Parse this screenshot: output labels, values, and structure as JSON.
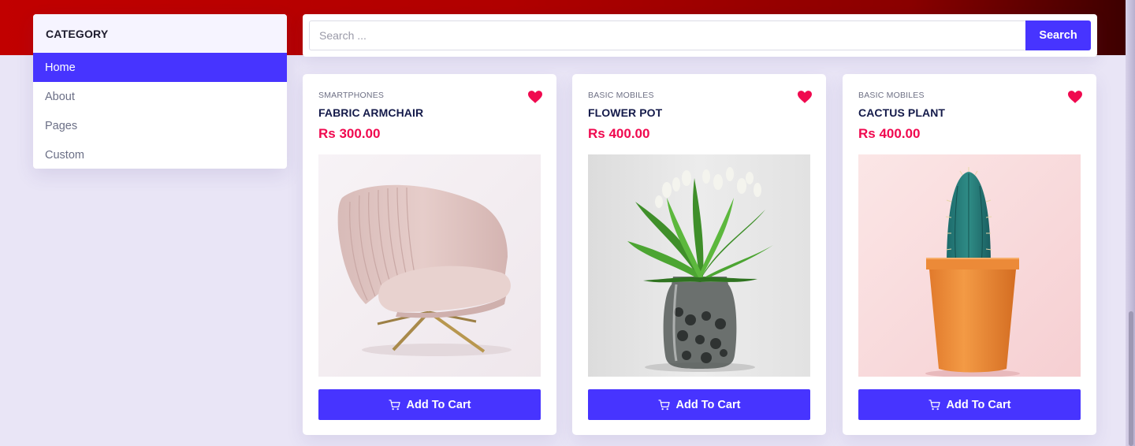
{
  "sidebar": {
    "header": "CATEGORY",
    "items": [
      {
        "label": "Home",
        "active": true
      },
      {
        "label": "About",
        "active": false
      },
      {
        "label": "Pages",
        "active": false
      },
      {
        "label": "Custom",
        "active": false
      }
    ]
  },
  "search": {
    "placeholder": "Search ...",
    "value": "",
    "button_label": "Search"
  },
  "products": [
    {
      "category": "SMARTPHONES",
      "title": "FABRIC ARMCHAIR",
      "price": "Rs 300.00",
      "button_label": "Add To Cart",
      "image": "armchair",
      "favorite": true
    },
    {
      "category": "BASIC MOBILES",
      "title": "FLOWER POT",
      "price": "Rs 400.00",
      "button_label": "Add To Cart",
      "image": "flower-pot",
      "favorite": true
    },
    {
      "category": "BASIC MOBILES",
      "title": "CACTUS PLANT",
      "price": "Rs 400.00",
      "button_label": "Add To Cart",
      "image": "cactus",
      "favorite": true
    }
  ],
  "icons": {
    "favorite": "heart-icon",
    "cart": "cart-icon"
  },
  "colors": {
    "accent": "#4734ff",
    "price": "#f0094f",
    "header_band": "#c10000",
    "background": "#e9e5f6"
  }
}
